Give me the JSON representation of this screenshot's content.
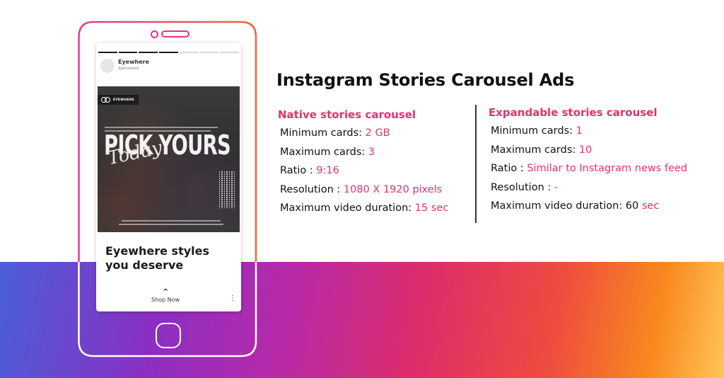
{
  "title": "Instagram Stories Carousel Ads",
  "colors": {
    "accent": "#e5306f",
    "text": "#111111",
    "gradient": [
      "#4a5fd8",
      "#8a2fc3",
      "#b82aa8",
      "#dd2d6a",
      "#ee4c3f",
      "#f98a1e",
      "#ffc45a"
    ]
  },
  "phone": {
    "story": {
      "progress_total": 7,
      "progress_filled": 4,
      "account_name": "Eyewhere",
      "account_subtitle": "Sponsored",
      "image_logo_text": "EYEWHERE",
      "image_headline": "PICK YOURS",
      "image_script": "Today",
      "headline": "Eyewhere styles you deserve",
      "cta_icon": "chevron-up-icon",
      "cta_label": "Shop Now",
      "more_icon": "more-vertical-icon",
      "more_glyph": "⋮",
      "chevron_glyph": "^"
    }
  },
  "columns": [
    {
      "heading": "Native stories carousel",
      "specs": [
        {
          "label": "Minimum cards: ",
          "value": "2 GB",
          "value_color": "accent"
        },
        {
          "label": "Maximum cards: ",
          "value": "3"
        },
        {
          "label": "Ratio : ",
          "value": "9:16"
        },
        {
          "label": "Resolution : ",
          "value": "1080 X 1920 pixels"
        },
        {
          "label": "Maximum video duration: ",
          "value": "15 sec"
        }
      ]
    },
    {
      "heading": "Expandable stories carousel",
      "specs": [
        {
          "label": "Minimum cards: ",
          "value": "1"
        },
        {
          "label": "Maximum cards: ",
          "value": "10"
        },
        {
          "label": "Ratio : ",
          "value": "Similar to Instagram news feed"
        },
        {
          "label": "Resolution : ",
          "value": "-"
        },
        {
          "label": "Maximum video duration: 60 ",
          "value": "sec"
        }
      ]
    }
  ]
}
